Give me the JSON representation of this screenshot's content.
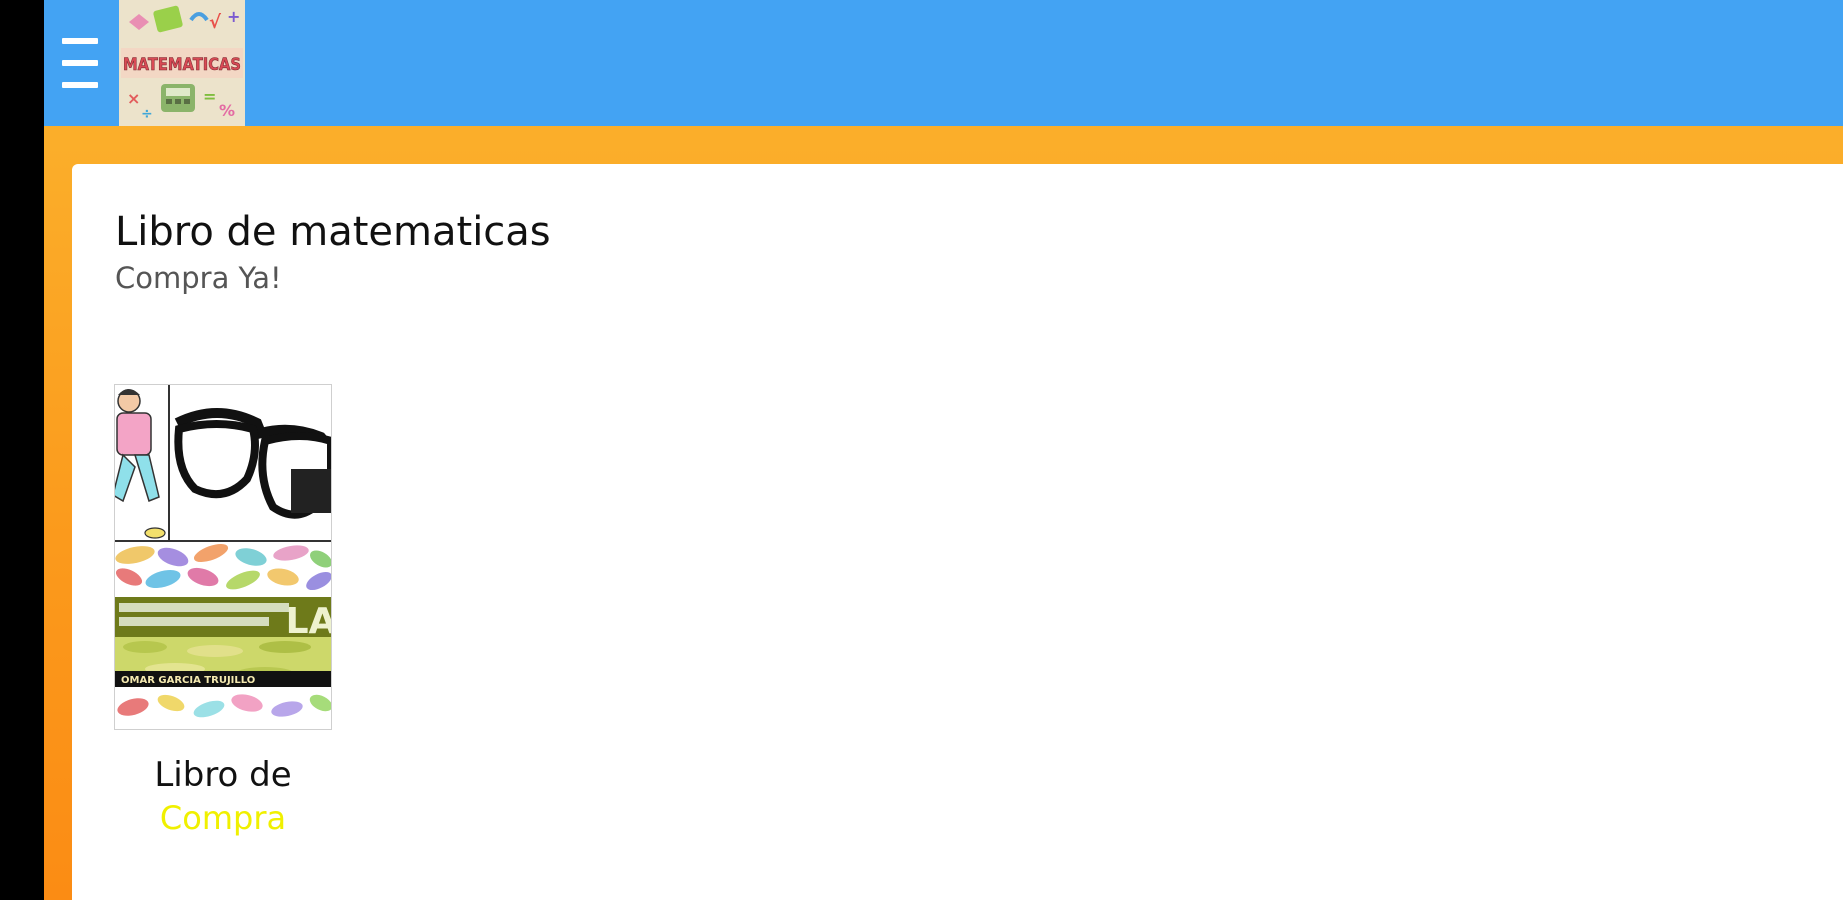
{
  "header": {
    "menu_icon": "hamburger-menu-icon",
    "logo_icon": "matematicas-logo",
    "logo_text": "MATEMATICAS",
    "bar_color": "#43a3f3"
  },
  "page": {
    "title": "Libro de matematicas",
    "subtitle": "Compra Ya!",
    "background_color": "#fbb52f"
  },
  "products": [
    {
      "name": "Libro de",
      "cta": "Compra",
      "cta_color": "#f0f000",
      "cover_icon": "book-cover-glasses",
      "cover_author": "OMAR GARCIA TRUJILLO"
    }
  ]
}
